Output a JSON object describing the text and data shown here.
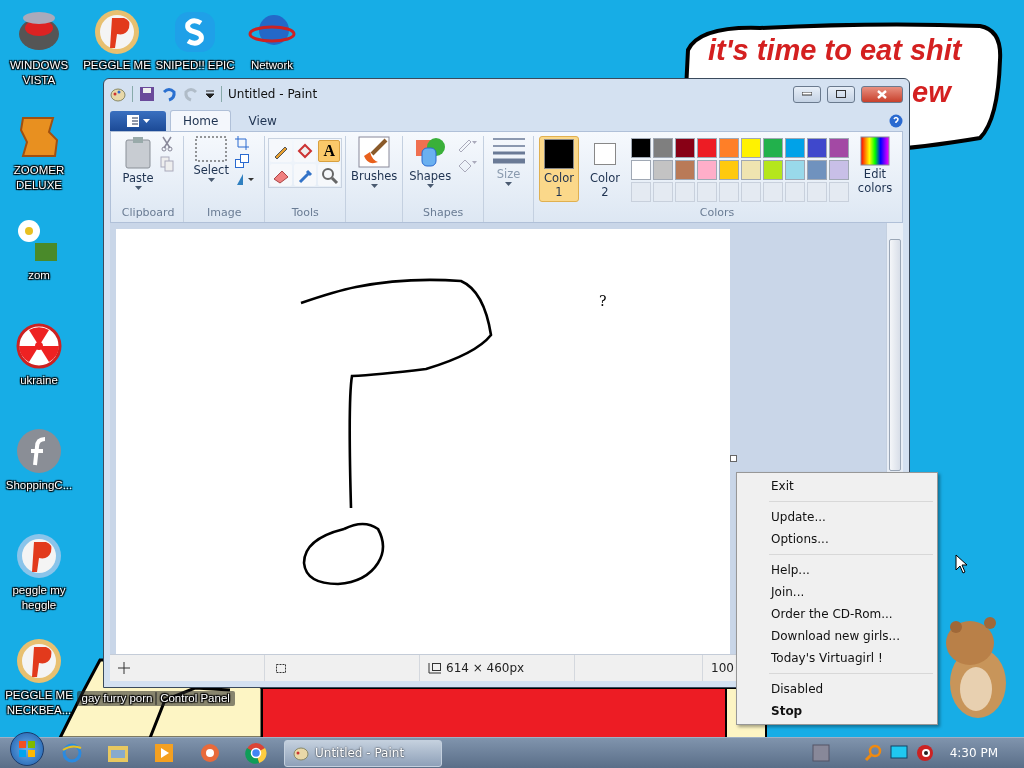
{
  "speech_bubble": {
    "line_1": "it's time to eat shit",
    "line_2": "ew"
  },
  "desktop_icons": [
    {
      "label": "WINDOWS VISTA"
    },
    {
      "label": "PEGGLE ME"
    },
    {
      "label": "SNIPED!! EPIC"
    },
    {
      "label": "Network"
    },
    {
      "label": "ZOOMER DELUXE"
    },
    {
      "label": "zom"
    },
    {
      "label": "ukraine"
    },
    {
      "label": "ShoppingC..."
    },
    {
      "label": "peggle my heggle"
    },
    {
      "label": "PEGGLE ME NECKBEA..."
    },
    {
      "label": "gay furry porn"
    },
    {
      "label": "Control Panel"
    }
  ],
  "paint_window": {
    "title": "Untitled - Paint",
    "tabs": [
      {
        "label": "Home",
        "selected": true
      },
      {
        "label": "View",
        "selected": false
      }
    ],
    "ribbon": {
      "paste": "Paste",
      "clipboard_group": "Clipboard",
      "select": "Select",
      "image_group": "Image",
      "tools": [
        {
          "kind": "pencil",
          "selected": false
        },
        {
          "kind": "fill",
          "selected": false
        },
        {
          "kind": "text",
          "glyph": "A",
          "selected": true
        },
        {
          "kind": "eraser",
          "selected": false
        },
        {
          "kind": "picker",
          "selected": false
        },
        {
          "kind": "magnifier",
          "selected": false
        }
      ],
      "tools_group": "Tools",
      "brushes": "Brushes",
      "shapes": "Shapes",
      "shapes_group": "Shapes",
      "size": "Size",
      "color_slots": [
        {
          "label": "Color 1",
          "color": "#000000",
          "selected": true
        },
        {
          "label": "Color 2",
          "color": "#ffffff",
          "selected": false
        }
      ],
      "palette": [
        {
          "color": "#000000"
        },
        {
          "color": "#7f7f7f"
        },
        {
          "color": "#880015"
        },
        {
          "color": "#ed1c24"
        },
        {
          "color": "#ff7f27"
        },
        {
          "color": "#fff200"
        },
        {
          "color": "#22b14c"
        },
        {
          "color": "#00a2e8"
        },
        {
          "color": "#3f48cc"
        },
        {
          "color": "#a349a4"
        },
        {
          "color": "#ffffff"
        },
        {
          "color": "#c3c3c3"
        },
        {
          "color": "#b97a57"
        },
        {
          "color": "#ffaec9"
        },
        {
          "color": "#ffc90e"
        },
        {
          "color": "#efe4b0"
        },
        {
          "color": "#b5e61d"
        },
        {
          "color": "#99d9ea"
        },
        {
          "color": "#7092be"
        },
        {
          "color": "#c8bfe7"
        },
        {
          "kind": "empty"
        },
        {
          "kind": "empty"
        },
        {
          "kind": "empty"
        },
        {
          "kind": "empty"
        },
        {
          "kind": "empty"
        },
        {
          "kind": "empty"
        },
        {
          "kind": "empty"
        },
        {
          "kind": "empty"
        },
        {
          "kind": "empty"
        },
        {
          "kind": "empty"
        }
      ],
      "edit_colors": "Edit colors",
      "colors_group": "Colors"
    },
    "canvas_text": "?",
    "status_bar": {
      "image_size": "614 × 460px",
      "zoom": "100"
    }
  },
  "context_menu": {
    "groups": [
      [
        {
          "label": "Exit",
          "default": false
        }
      ],
      [
        {
          "label": "Update...",
          "default": false
        },
        {
          "label": "Options...",
          "default": false
        }
      ],
      [
        {
          "label": "Help...",
          "default": false
        },
        {
          "label": "Join...",
          "default": false
        },
        {
          "label": "Order the CD-Rom...",
          "default": false
        },
        {
          "label": "Download new girls...",
          "default": false
        },
        {
          "label": "Today's Virtuagirl !",
          "default": false
        }
      ],
      [
        {
          "label": "Disabled",
          "default": false
        },
        {
          "label": "Stop",
          "default": true
        }
      ]
    ]
  },
  "taskbar": {
    "tasks": [
      {
        "label": "Untitled - Paint",
        "selected": true
      }
    ],
    "clock": "4:30 PM"
  }
}
